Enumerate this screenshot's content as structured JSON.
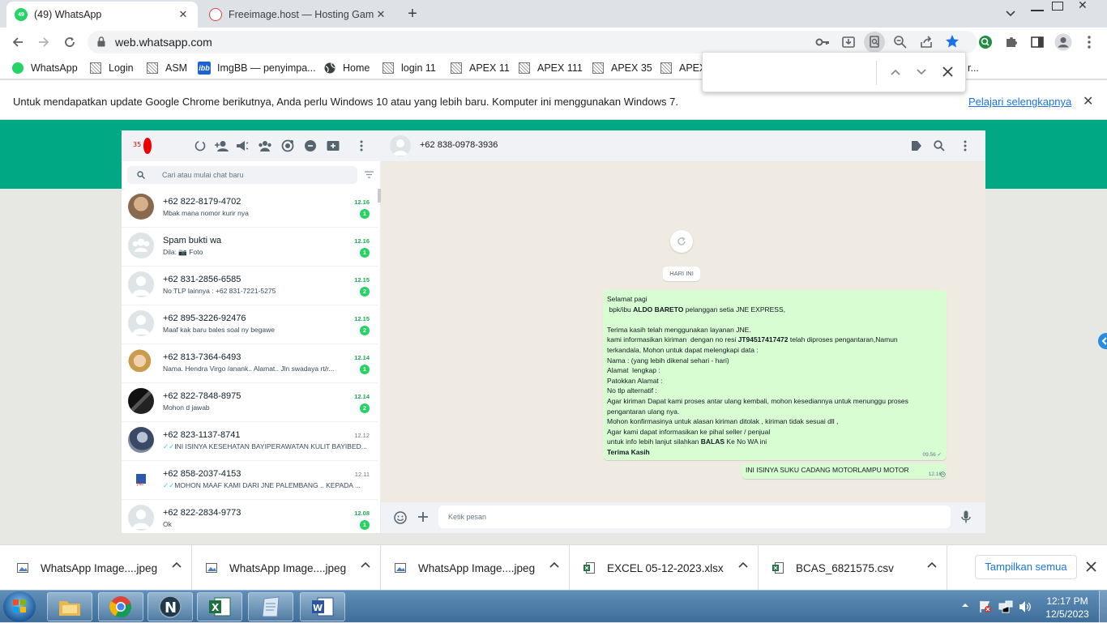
{
  "browser": {
    "tabs": [
      {
        "title": "(49) WhatsApp",
        "favicon_badge": "49",
        "active": true
      },
      {
        "title": "Freeimage.host — Hosting Gamb",
        "active": false
      }
    ],
    "url": "web.whatsapp.com",
    "bookmarks": [
      {
        "label": "WhatsApp",
        "icon": "whatsapp-icon"
      },
      {
        "label": "Login",
        "icon": "grid-icon"
      },
      {
        "label": "ASM",
        "icon": "grid-icon"
      },
      {
        "label": "ImgBB — penyimpa...",
        "icon": "imgbb-icon"
      },
      {
        "label": "Home",
        "icon": "globe-icon"
      },
      {
        "label": "login 11",
        "icon": "grid-icon"
      },
      {
        "label": "APEX 11",
        "icon": "grid-icon"
      },
      {
        "label": "APEX 111",
        "icon": "grid-icon"
      },
      {
        "label": "APEX 35",
        "icon": "grid-icon"
      },
      {
        "label": "APEX",
        "icon": "grid-icon"
      }
    ],
    "bookmark_overflow": "r...",
    "infobar": {
      "message": "Untuk mendapatkan update Google Chrome berikutnya, Anda perlu Windows 10 atau yang lebih baru. Komputer ini menggunakan Windows 7.",
      "link": "Pelajari selengkapnya"
    }
  },
  "whatsapp": {
    "search_placeholder": "Cari atau mulai chat baru",
    "chats": [
      {
        "name": "+62 822-8179-4702",
        "preview": "Mbak mana nomor kurir nya",
        "time": "12.16",
        "unread": "1",
        "avatar": "photo-1"
      },
      {
        "name": "Spam bukti wa",
        "preview": "Dila: 📷 Foto",
        "time": "12.16",
        "unread": "1",
        "avatar": "group"
      },
      {
        "name": "+62 831-2856-6585",
        "preview": "No TLP lainnya : +62 831-7221-5275",
        "time": "12.15",
        "unread": "2",
        "avatar": "default"
      },
      {
        "name": "+62 895-3226-92476",
        "preview": "Maaf kak baru bales soal ny begawe",
        "time": "12.15",
        "unread": "2",
        "avatar": "default"
      },
      {
        "name": "+62 813-7364-6493",
        "preview": "Nama. Hendra Virgo /anank.. Alamat.. Jln swadaya rt/r...",
        "time": "12.14",
        "unread": "1",
        "avatar": "photo-2"
      },
      {
        "name": "+62 822-7848-8975",
        "preview": "Mohon d jawab",
        "time": "12.14",
        "unread": "2",
        "avatar": "photo-3"
      },
      {
        "name": "+62 823-1137-8741",
        "preview": "INI ISINYA KESEHATAN BAYIPERAWATAN KULIT BAYIBED...",
        "time": "12.12",
        "unread": "",
        "ticks": "✓✓",
        "avatar": "photo-4"
      },
      {
        "name": "+62 858-2037-4153",
        "preview": "MOHON MAAF KAMI DARI JNE PALEMBANG .. KEPADA ...",
        "time": "12.11",
        "unread": "",
        "ticks": "✓✓",
        "avatar": "photo-5"
      },
      {
        "name": "+62 822-2834-9773",
        "preview": "Ok",
        "time": "12.08",
        "unread": "1",
        "avatar": "default"
      }
    ],
    "conversation": {
      "contact": "+62 838-0978-3936",
      "date_divider": "HARI INI",
      "messages": [
        {
          "lines": [
            {
              "text": "Selamat pagi"
            },
            {
              "text": " bpk/ibu ",
              "bold": "ALDO BARETO",
              "after": " pelanggan setia JNE EXPRESS,"
            },
            {
              "text": " "
            },
            {
              "text": "Terima kasih telah menggunakan layanan JNE."
            },
            {
              "text": "kami informasikan kiriman  dengan no resi ",
              "bold": "JT94517417472",
              "after": " telah diproses pengantaran,Namun"
            },
            {
              "text": "terkandala, Mohon untuk dapat melengkapi data :"
            },
            {
              "text": "Nama : (yang lebih dikenal sehari - hari)"
            },
            {
              "text": "Alamat  lengkap :"
            },
            {
              "text": "Patokkan Alamat :"
            },
            {
              "text": "No tlp alternatif :"
            },
            {
              "text": "Agar kiriman Dapat kami proses antar ulang kembali, mohon kesediannya untuk menunggu proses"
            },
            {
              "text": "pengantaran ulang nya."
            },
            {
              "text": "Mohon konfirmasinya untuk alasan kiriman ditolak , kiriman tidak sesuai dll ,"
            },
            {
              "text": "Agar kami dapat informasikan ke pihal seller / penjual"
            },
            {
              "text": "untuk info lebih lanjut silahkan ",
              "bold": "BALAS",
              "after": " Ke No WA ini"
            },
            {
              "text": "",
              "bold": "Terima Kasih",
              "after": ""
            }
          ],
          "time": "09.56",
          "status": "✓"
        },
        {
          "text": "INI ISINYA SUKU CADANG MOTORLAMPU MOTOR",
          "time": "12.16",
          "status": "pending"
        }
      ],
      "composer_placeholder": "Ketik pesan"
    }
  },
  "downloads": {
    "items": [
      {
        "name": "WhatsApp Image....jpeg",
        "icon": "image-file-icon"
      },
      {
        "name": "WhatsApp Image....jpeg",
        "icon": "image-file-icon"
      },
      {
        "name": "WhatsApp Image....jpeg",
        "icon": "image-file-icon"
      },
      {
        "name": "EXCEL 05-12-2023.xlsx",
        "icon": "excel-file-icon"
      },
      {
        "name": "BCAS_6821575.csv",
        "icon": "excel-file-icon"
      }
    ],
    "show_all": "Tampilkan semua"
  },
  "taskbar": {
    "apps": [
      "explorer-icon",
      "chrome-icon",
      "n-app-icon",
      "excel-icon",
      "notepad-icon",
      "word-icon"
    ],
    "time": "12:17 PM",
    "date": "12/5/2023"
  },
  "colors": {
    "wa_green": "#00a884",
    "bubble_out": "#d9fdd3",
    "unread_badge": "#25d366",
    "star_blue": "#1a73e8"
  }
}
